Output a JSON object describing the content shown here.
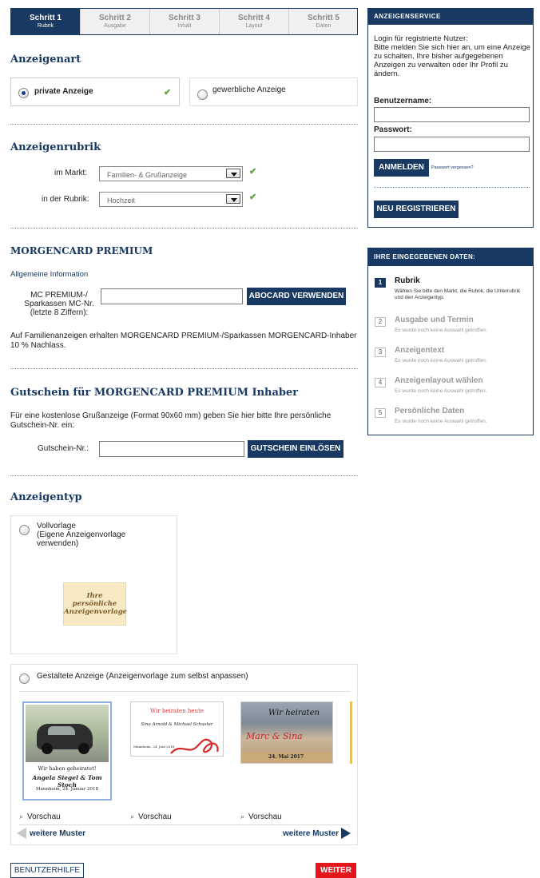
{
  "steps": [
    {
      "title": "Schritt 1",
      "sub": "Rubrik"
    },
    {
      "title": "Schritt 2",
      "sub": "Ausgabe"
    },
    {
      "title": "Schritt 3",
      "sub": "Inhalt"
    },
    {
      "title": "Schritt 4",
      "sub": "Layout"
    },
    {
      "title": "Schritt 5",
      "sub": "Daten"
    }
  ],
  "anzeigenart": {
    "heading": "Anzeigenart",
    "private": "private Anzeige",
    "business": "gewerbliche Anzeige",
    "check": "✔"
  },
  "rubrik": {
    "heading": "Anzeigenrubrik",
    "markt_label": "im Markt:",
    "markt_value": "Familien- & Grußanzeige",
    "rubrik_label": "in der Rubrik:",
    "rubrik_value": "Hochzeit"
  },
  "morgencard": {
    "heading": "MORGENCARD PREMIUM",
    "info": "Allgemeine Information",
    "label_line1": "MC PREMIUM-/",
    "label_line2": "Sparkassen MC-Nr.",
    "label_line3": "(letzte 8 Ziffern):",
    "button": "ABOCARD VERWENDEN",
    "note": "Auf Familienanzeigen erhalten MORGENCARD PREMIUM-/Sparkassen MORGENCARD-Inhaber 10 % Nachlass."
  },
  "gutschein": {
    "heading": "Gutschein für MORGENCARD PREMIUM Inhaber",
    "text": "Für eine kostenlose Grußanzeige (Format 90x60 mm) geben Sie hier bitte Ihre persönliche Gutschein-Nr. ein:",
    "label": "Gutschein-Nr.:",
    "button": "GUTSCHEIN EINLÖSEN"
  },
  "anzeigentyp": {
    "heading": "Anzeigentyp",
    "voll_line1": "Vollvorlage",
    "voll_line2": "(Eigene Anzeigenvorlage",
    "voll_line3": "verwenden)",
    "voll_img_line1": "Ihre",
    "voll_img_line2": "persönliche",
    "voll_img_line3": "Anzeigenvorlage",
    "gestaltet": "Gestaltete Anzeige (Anzeigenvorlage zum selbst anpassen)",
    "templates": [
      {
        "caption": "Wir haben geheiratet!",
        "names": "Angela Siegel & Tom Stoch",
        "place": "Mannheim, 24. Januar 2018",
        "preview": "Vorschau"
      },
      {
        "title": "Wir heiraten heute",
        "names": "Sina Arnold & Michael Schuster",
        "place": "Mannheim, 24. Juni 2018",
        "preview": "Vorschau"
      },
      {
        "title": "Wir heiraten",
        "names": "Marc & Sina",
        "date": "24. Mai 2017",
        "preview": "Vorschau"
      }
    ],
    "prev": "weitere Muster",
    "next": "weitere Muster"
  },
  "footer": {
    "help": "BENUTZERHILFE",
    "next": "WEITER"
  },
  "service": {
    "header": "ANZEIGENSERVICE",
    "intro": "Login für registrierte Nutzer:",
    "text": "Bitte melden Sie sich hier an, um eine Anzeige zu schalten, Ihre bisher aufgegebenen Anzeigen zu verwalten oder Ihr Profil zu ändern.",
    "user_label": "Benutzername:",
    "pass_label": "Passwort:",
    "login": "ANMELDEN",
    "forgot": "Passwort vergessen?",
    "register": "NEU REGISTRIEREN"
  },
  "data_panel": {
    "header": "IHRE EINGEGEBENEN DATEN:",
    "steps": [
      {
        "n": "1",
        "title": "Rubrik",
        "desc": "Wählen Sie bitte den Markt, die Rubrik, die Unterrubrik und den Anzeigentyp."
      },
      {
        "n": "2",
        "title": "Ausgabe und Termin",
        "desc": "Es wurde noch keine Auswahl getroffen."
      },
      {
        "n": "3",
        "title": "Anzeigentext",
        "desc": "Es wurde noch keine Auswahl getroffen."
      },
      {
        "n": "4",
        "title": "Anzeigenlayout wählen",
        "desc": "Es wurde noch keine Auswahl getroffen."
      },
      {
        "n": "5",
        "title": "Persönliche Daten",
        "desc": "Es wurde noch keine Auswahl getroffen."
      }
    ]
  },
  "colors": {
    "navy": "#173962",
    "check": "#5aa236",
    "red": "#e3161b"
  }
}
